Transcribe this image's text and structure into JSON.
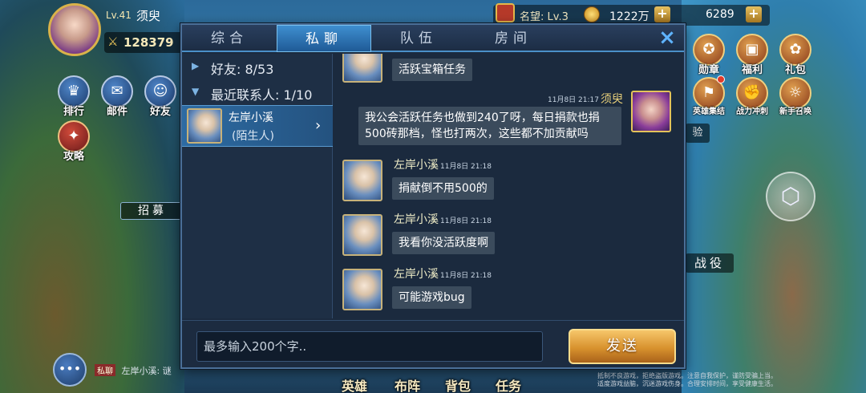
{
  "hud": {
    "level": "Lv.41",
    "player_name": "须臾",
    "power": "128379",
    "fame_label": "名望: Lv.3",
    "coins": "1222万",
    "gems": "6289",
    "recruit": "招募",
    "battle": "战役",
    "exp_tag": "验",
    "left_buttons": [
      {
        "label": "排行",
        "icon": "trophy-icon"
      },
      {
        "label": "邮件",
        "icon": "mail-icon"
      },
      {
        "label": "好友",
        "icon": "friends-icon"
      },
      {
        "label": "攻略",
        "icon": "guide-icon"
      }
    ],
    "right_buttons": [
      {
        "label": "勋章",
        "icon": "medal-icon"
      },
      {
        "label": "福利",
        "icon": "gift-box-icon"
      },
      {
        "label": "礼包",
        "icon": "gift-icon"
      },
      {
        "label": "英雄集结",
        "icon": "hero-icon"
      },
      {
        "label": "战力冲刺",
        "icon": "power-icon"
      },
      {
        "label": "新手召唤",
        "icon": "summon-icon"
      }
    ],
    "bottom_nav": [
      "英雄",
      "布阵",
      "背包",
      "任务"
    ],
    "bottom_chat": {
      "tag": "私聊",
      "text": "左岸小溪: 谜"
    },
    "notice": "抵制不良游戏，拒绝盗版游戏。注意自我保护，谨防受骗上当。适度游戏益脑，沉迷游戏伤身。合理安排时间，享受健康生活。"
  },
  "dialog": {
    "tabs": [
      {
        "label": "综合",
        "active": false
      },
      {
        "label": "私聊",
        "active": true
      },
      {
        "label": "队伍",
        "active": false
      },
      {
        "label": "房间",
        "active": false
      }
    ],
    "close_icon": "×",
    "contacts": {
      "friends_label": "好友: 8/53",
      "recent_label": "最近联系人: 1/10",
      "selected": {
        "name": "左岸小溪",
        "status": "(陌生人)"
      }
    },
    "messages": [
      {
        "sender": "左岸小溪",
        "time": "",
        "text": "活跃宝箱任务",
        "self": false
      },
      {
        "sender": "须臾",
        "time": "11月8日 21:17",
        "text": "我公会活跃任务也做到240了呀，每日捐款也捐500砖那档，怪也打两次，这些都不加贡献吗",
        "self": true
      },
      {
        "sender": "左岸小溪",
        "time": "11月8日 21:18",
        "text": "捐献倒不用500的",
        "self": false
      },
      {
        "sender": "左岸小溪",
        "time": "11月8日 21:18",
        "text": "我看你没活跃度啊",
        "self": false
      },
      {
        "sender": "左岸小溪",
        "time": "11月8日 21:18",
        "text": "可能游戏bug",
        "self": false
      }
    ],
    "input_placeholder": "最多输入200个字..",
    "send_label": "发送"
  },
  "colors": {
    "accent": "#3f8fd0",
    "send_button": "#d8922e",
    "bubble": "#3b4b5c",
    "panel": "#1b2a3e"
  }
}
